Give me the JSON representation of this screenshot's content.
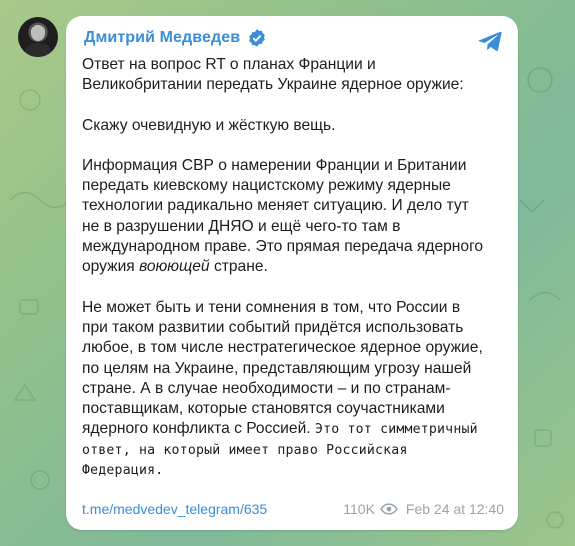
{
  "post": {
    "author": "Дмитрий Медведев",
    "line1": "Ответ на вопрос RT о планах Франции и",
    "line2": "Великобритании передать Украине ядерное оружие:",
    "p2": "Скажу очевидную и жёсткую вещь.",
    "p3_l1": "Информация СВР о намерении Франции и Британии",
    "p3_l2": "передать киевскому нацистскому режиму ядерные",
    "p3_l3": "технологии радикально меняет ситуацию. И дело тут",
    "p3_l4": "не в разрушении ДНЯО и ещё чего-то там в",
    "p3_l5": "международном праве. Это прямая передача ядерного",
    "p3_l6_a": "оружия ",
    "p3_l6_b": "воюющей",
    "p3_l6_c": " стране.",
    "p4_l1": "Не может быть и тени сомнения в том, что России в",
    "p4_l2": "при таком развитии событий придётся использовать",
    "p4_l3": "любое, в том числе нестратегическое ядерное оружие,",
    "p4_l4": "по целям на Украине, представляющим угрозу нашей",
    "p4_l5": "стране. А в случае необходимости – и по странам-",
    "p4_l6": "поставщикам, которые становятся соучастниками",
    "p4_l7_a": "ядерного конфликта с Россией. ",
    "p4_l7_b": "Это тот симметричный",
    "p4_l8": "ответ, на который имеет право Российская",
    "p4_l9": "Федерация.",
    "link": "t.me/medvedev_telegram/635",
    "views": "110K",
    "date": "Feb 24 at 12:40"
  },
  "colors": {
    "accent": "#3a8dd6",
    "text": "#1d1d1d",
    "meta": "#9aa3ab",
    "background": "#8fbf8c"
  },
  "icons": {
    "verified": "verified-badge-icon",
    "share": "telegram-share-icon",
    "views": "eye-icon"
  }
}
